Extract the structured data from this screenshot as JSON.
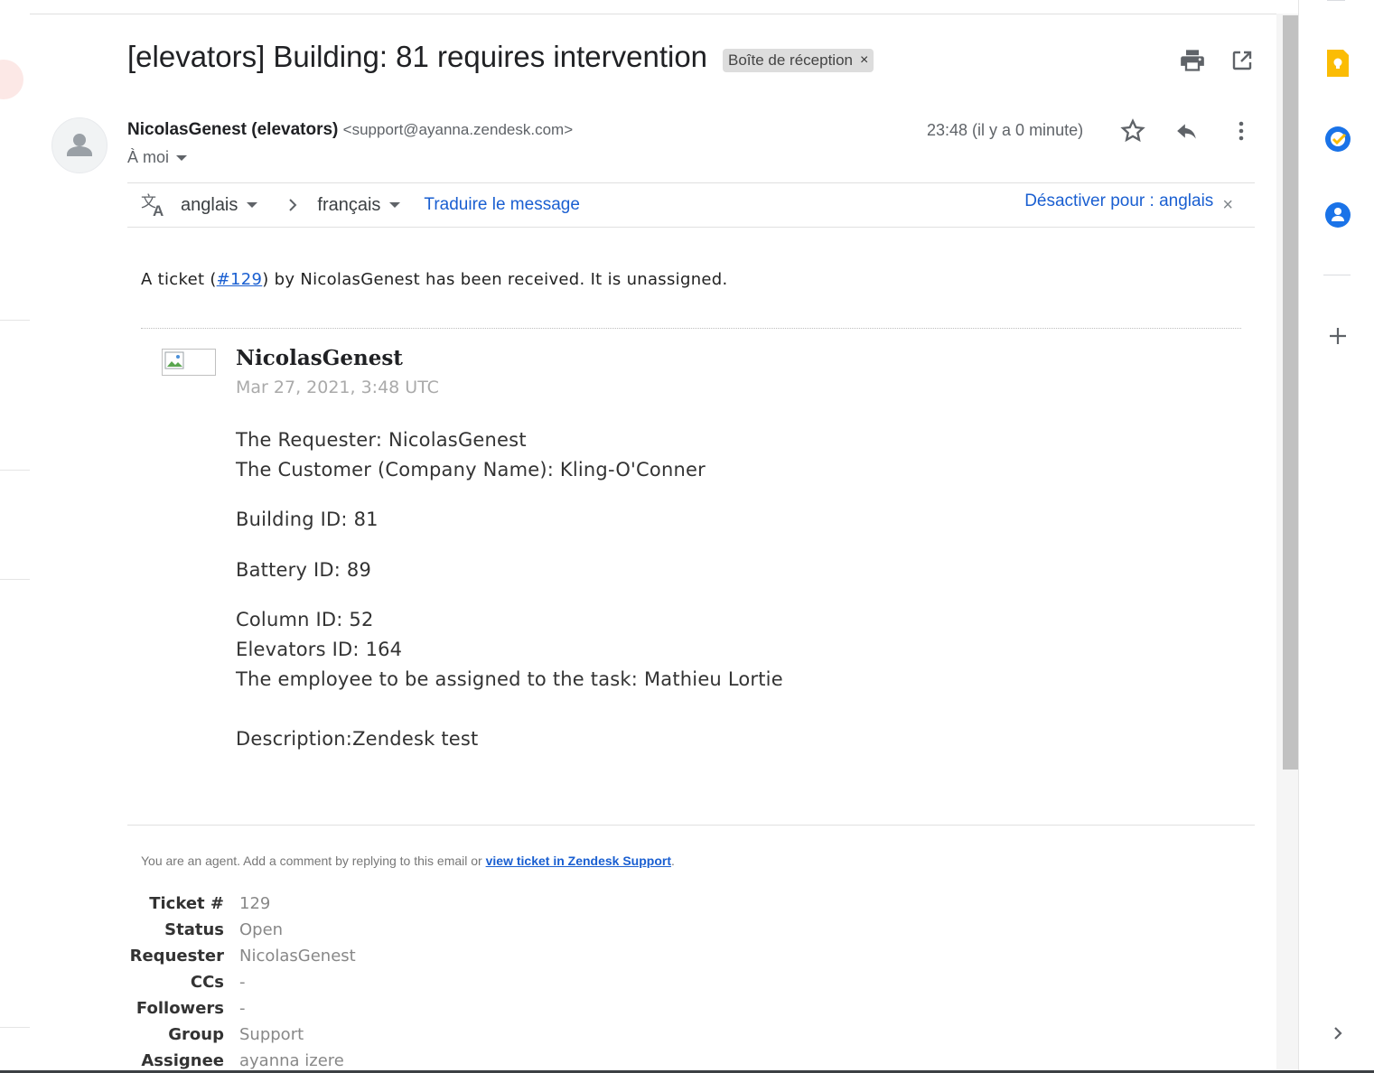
{
  "email": {
    "subject": "[elevators] Building: 81 requires intervention",
    "label": "Boîte de réception",
    "label_remove": "×",
    "sender_name": "NicolasGenest (elevators)",
    "sender_email": "<support@ayanna.zendesk.com>",
    "recipient": "À moi",
    "time": "23:48 (il y a 0 minute)"
  },
  "translate": {
    "source_lang": "anglais",
    "target_lang": "français",
    "translate_link": "Traduire le message",
    "disable_link": "Désactiver pour : anglais",
    "disable_close": "×"
  },
  "body": {
    "intro_prefix": "A ticket (",
    "ticket_link": "#129",
    "intro_suffix": ") by NicolasGenest has been received. It is unassigned.",
    "author": "NicolasGenest",
    "date": "Mar 27, 2021, 3:48 UTC",
    "lines": [
      "The Requester: NicolasGenest",
      "The Customer (Company Name): Kling-O'Conner",
      "Building ID: 81",
      "Battery ID: 89",
      "Column ID: 52",
      "Elevators ID: 164",
      "The employee to be assigned to the task: Mathieu Lortie",
      "Description:Zendesk test"
    ]
  },
  "footer": {
    "note_prefix": "You are an agent. Add a comment by replying to this email or ",
    "note_link": "view ticket in Zendesk Support",
    "note_suffix": ".",
    "ticket_info": [
      {
        "key": "Ticket #",
        "value": "129"
      },
      {
        "key": "Status",
        "value": "Open"
      },
      {
        "key": "Requester",
        "value": "NicolasGenest"
      },
      {
        "key": "CCs",
        "value": "-"
      },
      {
        "key": "Followers",
        "value": "-"
      },
      {
        "key": "Group",
        "value": "Support"
      },
      {
        "key": "Assignee",
        "value": "ayanna izere"
      }
    ]
  },
  "icons": {
    "print": "print-icon",
    "open_new": "open-in-new-window-icon",
    "star": "star-icon",
    "reply": "reply-icon",
    "more": "more-vertical-icon",
    "translate": "translate-icon",
    "keep": "keep-icon",
    "tasks": "tasks-icon",
    "contacts": "contacts-icon",
    "add": "plus-icon",
    "expand": "chevron-right-icon"
  },
  "colors": {
    "link": "#1a5fd1",
    "keep": "#fbbc04",
    "tasks": "#1a73e8",
    "contacts": "#1a73e8"
  }
}
